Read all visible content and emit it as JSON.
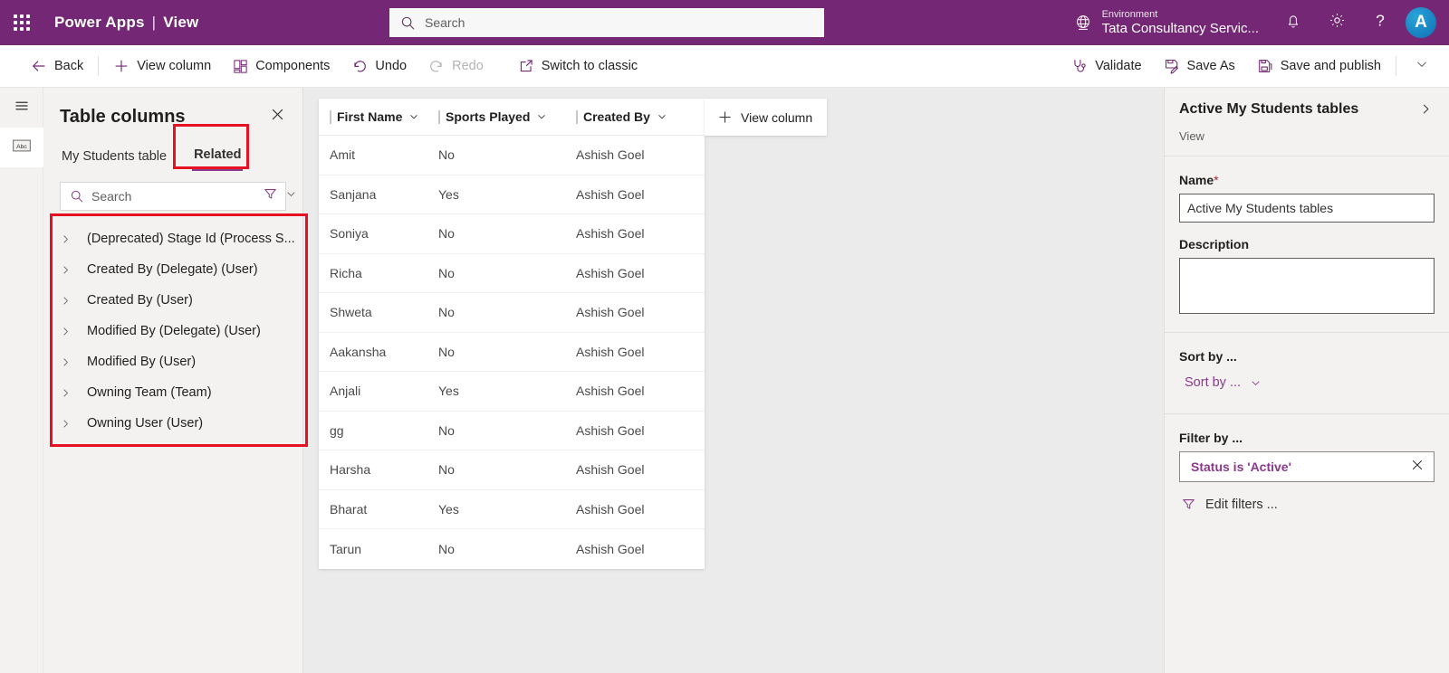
{
  "colors": {
    "brand_purple": "#742774",
    "accent_purple": "#8a3a8a",
    "annotation_red": "#e81123",
    "required_red": "#a4262c"
  },
  "suitebar": {
    "waffle_icon": "waffle-grid-icon",
    "brand": "Power Apps",
    "separator": "|",
    "page": "View",
    "search": {
      "icon": "search-icon",
      "placeholder": "Search",
      "value": ""
    },
    "environment": {
      "icon": "globe-icon",
      "label": "Environment",
      "name": "Tata Consultancy Servic..."
    },
    "notifications_icon": "bell-icon",
    "settings_icon": "gear-icon",
    "help_icon": "question-mark-icon",
    "avatar_initial": "A"
  },
  "commandbar": {
    "left": [
      {
        "icon": "arrow-left-icon",
        "label": "Back",
        "disabled": false
      },
      {
        "icon": "plus-icon",
        "label": "View column",
        "disabled": false
      },
      {
        "icon": "components-icon",
        "label": "Components",
        "disabled": false
      },
      {
        "icon": "undo-icon",
        "label": "Undo",
        "disabled": false
      },
      {
        "icon": "redo-icon",
        "label": "Redo",
        "disabled": true
      },
      {
        "icon": "external-link-icon",
        "label": "Switch to classic",
        "disabled": false
      }
    ],
    "right": [
      {
        "icon": "stethoscope-icon",
        "label": "Validate"
      },
      {
        "icon": "save-as-icon",
        "label": "Save As"
      },
      {
        "icon": "save-publish-icon",
        "label": "Save and publish"
      }
    ],
    "overflow_icon": "chevron-down-icon"
  },
  "rail": {
    "items": [
      {
        "icon": "hamburger-menu-icon",
        "name": "expand-navigation",
        "selected": false
      },
      {
        "icon": "abc-text-column-icon",
        "name": "table-columns-rail",
        "selected": true
      }
    ]
  },
  "left_panel": {
    "title": "Table columns",
    "close_icon": "close-icon",
    "tabs": [
      {
        "label": "My Students table",
        "active": false
      },
      {
        "label": "Related",
        "active": true
      }
    ],
    "search": {
      "icon": "search-icon",
      "placeholder": "Search",
      "value": "",
      "filter_icon": "filter-icon",
      "chevron_icon": "chevron-down-icon"
    },
    "items": [
      {
        "expand_icon": "chevron-right-icon",
        "label": "(Deprecated) Stage Id (Process S..."
      },
      {
        "expand_icon": "chevron-right-icon",
        "label": "Created By (Delegate) (User)"
      },
      {
        "expand_icon": "chevron-right-icon",
        "label": "Created By (User)"
      },
      {
        "expand_icon": "chevron-right-icon",
        "label": "Modified By (Delegate) (User)"
      },
      {
        "expand_icon": "chevron-right-icon",
        "label": "Modified By (User)"
      },
      {
        "expand_icon": "chevron-right-icon",
        "label": "Owning Team (Team)"
      },
      {
        "expand_icon": "chevron-right-icon",
        "label": "Owning User (User)"
      }
    ]
  },
  "grid": {
    "columns": [
      {
        "label": "First Name",
        "sort_icon": "chevron-down-icon"
      },
      {
        "label": "Sports Played",
        "sort_icon": "chevron-down-icon"
      },
      {
        "label": "Created By",
        "sort_icon": "chevron-down-icon"
      }
    ],
    "add_column": {
      "icon": "plus-icon",
      "label": "View column"
    },
    "rows": [
      {
        "first_name": "Amit",
        "sports_played": "No",
        "created_by": "Ashish Goel"
      },
      {
        "first_name": "Sanjana",
        "sports_played": "Yes",
        "created_by": "Ashish Goel"
      },
      {
        "first_name": "Soniya",
        "sports_played": "No",
        "created_by": "Ashish Goel"
      },
      {
        "first_name": "Richa",
        "sports_played": "No",
        "created_by": "Ashish Goel"
      },
      {
        "first_name": "Shweta",
        "sports_played": "No",
        "created_by": "Ashish Goel"
      },
      {
        "first_name": "Aakansha",
        "sports_played": "No",
        "created_by": "Ashish Goel"
      },
      {
        "first_name": "Anjali",
        "sports_played": "Yes",
        "created_by": "Ashish Goel"
      },
      {
        "first_name": "gg",
        "sports_played": "No",
        "created_by": "Ashish Goel"
      },
      {
        "first_name": "Harsha",
        "sports_played": "No",
        "created_by": "Ashish Goel"
      },
      {
        "first_name": "Bharat",
        "sports_played": "Yes",
        "created_by": "Ashish Goel"
      },
      {
        "first_name": "Tarun",
        "sports_played": "No",
        "created_by": "Ashish Goel"
      }
    ]
  },
  "right_panel": {
    "title": "Active My Students tables",
    "expand_icon": "chevron-right-icon",
    "subtitle": "View",
    "name_label": "Name",
    "name_required_mark": "*",
    "name_value": "Active My Students tables",
    "description_label": "Description",
    "description_value": "",
    "sort_label": "Sort by ...",
    "sort_dropdown_value": "Sort by ...",
    "sort_dropdown_icon": "chevron-down-icon",
    "filter_label": "Filter by ...",
    "filter_pill_text": "Status is 'Active'",
    "filter_pill_remove_icon": "close-icon",
    "edit_filters_icon": "filter-icon",
    "edit_filters_label": "Edit filters ..."
  }
}
